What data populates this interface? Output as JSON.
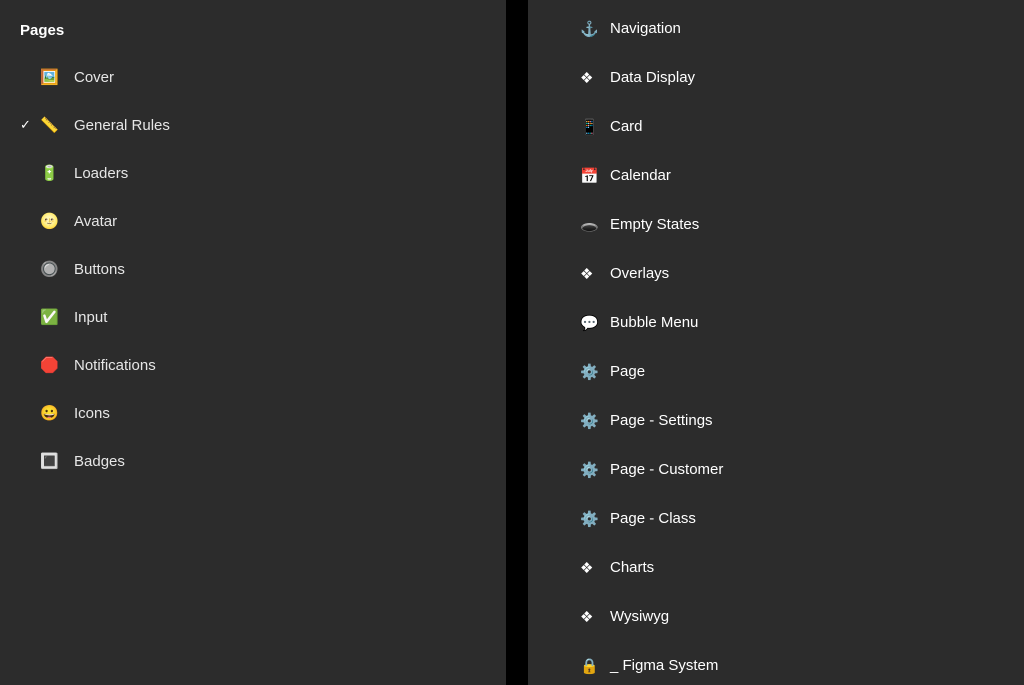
{
  "left": {
    "title": "Pages",
    "selected_index": 1,
    "items": [
      {
        "icon": "🖼️",
        "label": "Cover"
      },
      {
        "icon": "📏",
        "label": "General Rules"
      },
      {
        "icon": "🔋",
        "label": "Loaders"
      },
      {
        "icon": "🌝",
        "label": "Avatar"
      },
      {
        "icon": "🔘",
        "label": "Buttons"
      },
      {
        "icon": "✅",
        "label": "Input"
      },
      {
        "icon": "🛑",
        "label": "Notifications"
      },
      {
        "icon": "😀",
        "label": "Icons"
      },
      {
        "icon": "🔳",
        "label": "Badges"
      }
    ]
  },
  "right": {
    "items": [
      {
        "icon": "⚓",
        "label": "Navigation"
      },
      {
        "icon": "❖",
        "label": "Data Display"
      },
      {
        "icon": "📱",
        "label": "Card"
      },
      {
        "icon": "📅",
        "label": "Calendar"
      },
      {
        "icon": "🕳️",
        "label": "Empty States"
      },
      {
        "icon": "❖",
        "label": "Overlays"
      },
      {
        "icon": "💬",
        "label": "Bubble Menu"
      },
      {
        "icon": "⚙️",
        "label": "Page"
      },
      {
        "icon": "⚙️",
        "label": "Page - Settings"
      },
      {
        "icon": "⚙️",
        "label": "Page - Customer"
      },
      {
        "icon": "⚙️",
        "label": "Page - Class"
      },
      {
        "icon": "❖",
        "label": "Charts"
      },
      {
        "icon": "❖",
        "label": "Wysiwyg"
      },
      {
        "icon": "🔒",
        "label": "_ Figma System"
      }
    ]
  }
}
